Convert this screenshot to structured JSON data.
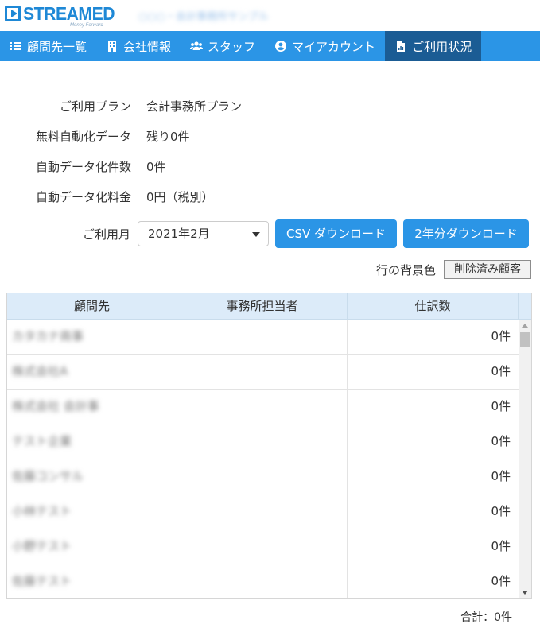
{
  "brand": {
    "logo_text": "STREAMED",
    "logo_sub": "Money Forward",
    "firm_name": "○○○・会計事務所サンプル"
  },
  "nav": [
    {
      "label": "顧問先一覧",
      "icon": "list-icon",
      "active": false
    },
    {
      "label": "会社情報",
      "icon": "building-icon",
      "active": false
    },
    {
      "label": "スタッフ",
      "icon": "users-icon",
      "active": false
    },
    {
      "label": "マイアカウント",
      "icon": "user-circle-icon",
      "active": false
    },
    {
      "label": "ご利用状況",
      "icon": "file-chart-icon",
      "active": true
    }
  ],
  "info": {
    "plan_label": "ご利用プラン",
    "plan_value": "会計事務所プラン",
    "free_label": "無料自動化データ",
    "free_value": "残り0件",
    "count_label": "自動データ化件数",
    "count_value": "0件",
    "fee_label": "自動データ化料金",
    "fee_value": "0円（税別）"
  },
  "controls": {
    "month_label": "ご利用月",
    "month_value": "2021年2月",
    "csv_button": "CSV ダウンロード",
    "two_year_button": "2年分ダウンロード",
    "bg_color_label": "行の背景色",
    "deleted_legend": "削除済み顧客"
  },
  "table": {
    "headers": [
      "顧問先",
      "事務所担当者",
      "仕訳数"
    ],
    "rows": [
      {
        "client": "カタカナ商事",
        "staff": "",
        "count": "0件"
      },
      {
        "client": "株式会社A",
        "staff": "",
        "count": "0件"
      },
      {
        "client": "株式会社 会計事",
        "staff": "",
        "count": "0件"
      },
      {
        "client": "テスト企業",
        "staff": "",
        "count": "0件"
      },
      {
        "client": "佐藤コンサル",
        "staff": "",
        "count": "0件"
      },
      {
        "client": "小林テスト",
        "staff": "",
        "count": "0件"
      },
      {
        "client": "小野テスト",
        "staff": "",
        "count": "0件"
      },
      {
        "client": "佐藤テスト",
        "staff": "",
        "count": "0件"
      }
    ]
  },
  "total": "合計：0件",
  "colors": {
    "primary": "#2b95e6",
    "nav_active": "#1b5c94",
    "table_header": "#dcebf9"
  }
}
